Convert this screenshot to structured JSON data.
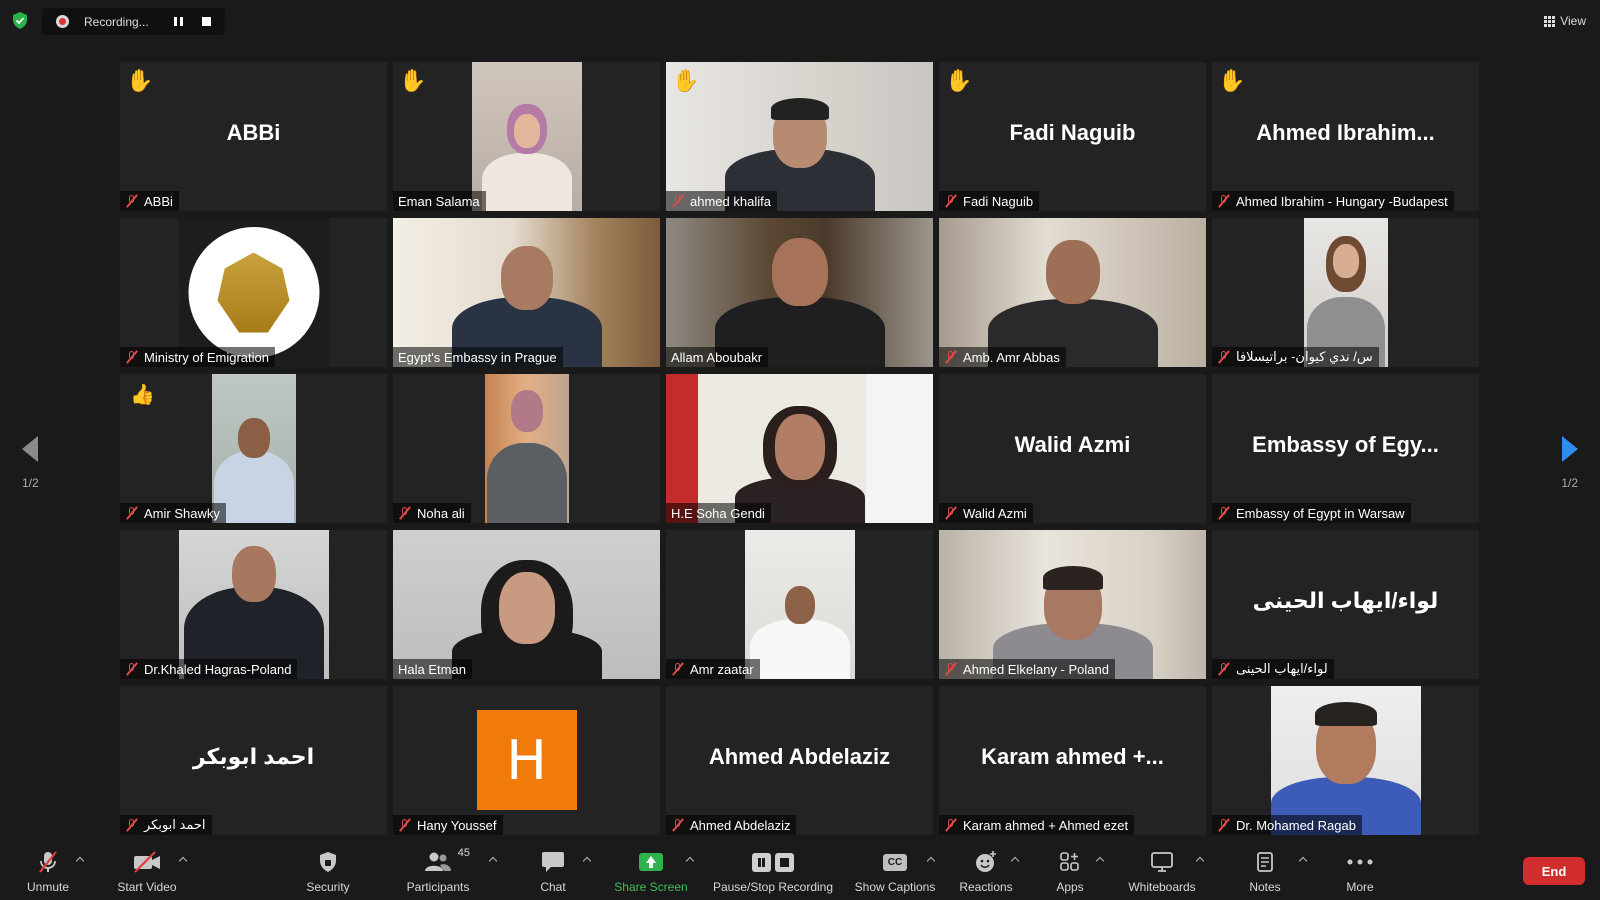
{
  "recording": {
    "label": "Recording..."
  },
  "view_button": {
    "label": "View"
  },
  "pagination": {
    "left": "1/2",
    "right": "1/2"
  },
  "tiles": [
    {
      "name": "ABBi",
      "display_name": "ABBi",
      "muted": true,
      "reaction": "raised-hand"
    },
    {
      "name": "Eman Salama",
      "muted": false,
      "reaction": "raised-hand"
    },
    {
      "name": "ahmed khalifa",
      "muted": true,
      "reaction": "raised-hand"
    },
    {
      "name": "Fadi Naguib",
      "display_name": "Fadi Naguib",
      "muted": true,
      "reaction": "raised-hand"
    },
    {
      "name": "Ahmed Ibrahim - Hungary -Budapest",
      "display_name": "Ahmed  Ibrahim...",
      "muted": true,
      "reaction": "raised-hand"
    },
    {
      "name": "Ministry of Emigration",
      "muted": true
    },
    {
      "name": "Egypt's Embassy in Prague",
      "muted": false
    },
    {
      "name": "Allam Aboubakr",
      "muted": false
    },
    {
      "name": "Amb. Amr Abbas",
      "muted": true
    },
    {
      "name": "س/ ندي كيوان- براتيسلافا",
      "muted": true
    },
    {
      "name": "Amir Shawky",
      "muted": true,
      "reaction": "thumbs-up"
    },
    {
      "name": "Noha ali",
      "muted": true
    },
    {
      "name": "H.E Soha Gendi",
      "muted": false,
      "active_speaker": true
    },
    {
      "name": "Walid Azmi",
      "display_name": "Walid Azmi",
      "muted": true
    },
    {
      "name": "Embassy of Egypt in Warsaw",
      "display_name": "Embassy  of  Egy...",
      "muted": true
    },
    {
      "name": "Dr.Khaled Hagras-Poland",
      "muted": true
    },
    {
      "name": "Hala Etman",
      "muted": false
    },
    {
      "name": "Amr zaatar",
      "muted": true
    },
    {
      "name": "Ahmed Elkelany - Poland",
      "muted": true
    },
    {
      "name": "لواء/ايهاب الحينى",
      "display_name": "لواء/ايهاب الحينى",
      "muted": true
    },
    {
      "name": "احمد ابوبكر",
      "display_name": "احمد ابوبكر",
      "muted": true
    },
    {
      "name": "Hany Youssef",
      "muted": true,
      "avatar_letter": "H"
    },
    {
      "name": "Ahmed Abdelaziz",
      "display_name": "Ahmed Abdelaziz",
      "muted": true
    },
    {
      "name": "Karam ahmed + Ahmed ezet",
      "display_name": "Karam  ahmed  +...",
      "muted": true
    },
    {
      "name": "Dr. Mohamed Ragab",
      "muted": true
    }
  ],
  "toolbar": {
    "unmute": "Unmute",
    "start_video": "Start Video",
    "security": "Security",
    "participants": "Participants",
    "participants_count": "45",
    "chat": "Chat",
    "share_screen": "Share Screen",
    "pause_stop_recording": "Pause/Stop Recording",
    "show_captions": "Show Captions",
    "captions_icon": "CC",
    "reactions": "Reactions",
    "apps": "Apps",
    "whiteboards": "Whiteboards",
    "notes": "Notes",
    "more": "More",
    "end": "End"
  },
  "colors": {
    "active_speaker": "#d7e64a",
    "share_green": "#2fb14e",
    "end_red": "#d12d2d",
    "avatar_orange": "#f07b0a"
  }
}
